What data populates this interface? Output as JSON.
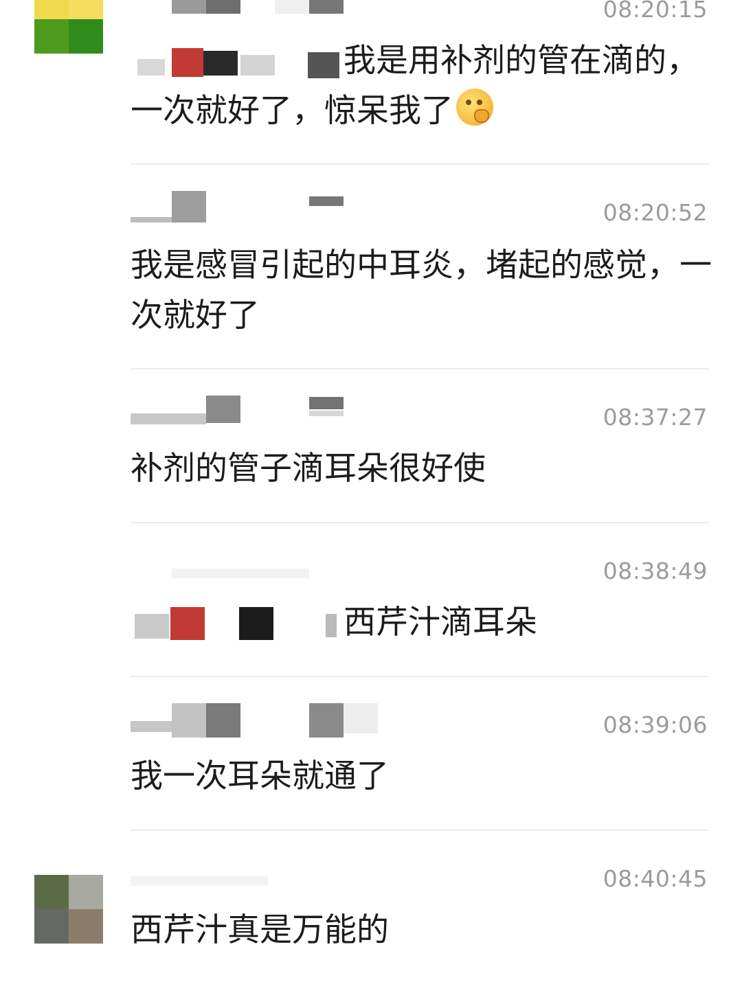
{
  "comments": [
    {
      "time": "08:20:15",
      "text": "我是用补剂的管在滴的，一次就好了，惊呆我了",
      "emoji": "thinking-face-emoji"
    },
    {
      "time": "08:20:52",
      "text": "我是感冒引起的中耳炎，堵起的感觉，一次就好了"
    },
    {
      "time": "08:37:27",
      "text": "补剂的管子滴耳朵很好使"
    },
    {
      "time": "08:38:49",
      "text": "西芹汁滴耳朵"
    },
    {
      "time": "08:39:06",
      "text": "我一次耳朵就通了"
    },
    {
      "time": "08:40:45",
      "text": "西芹汁真是万能的"
    }
  ],
  "colors": {
    "time": "#9b9b9b",
    "text": "#1c1c1c",
    "divider": "#ececec"
  }
}
